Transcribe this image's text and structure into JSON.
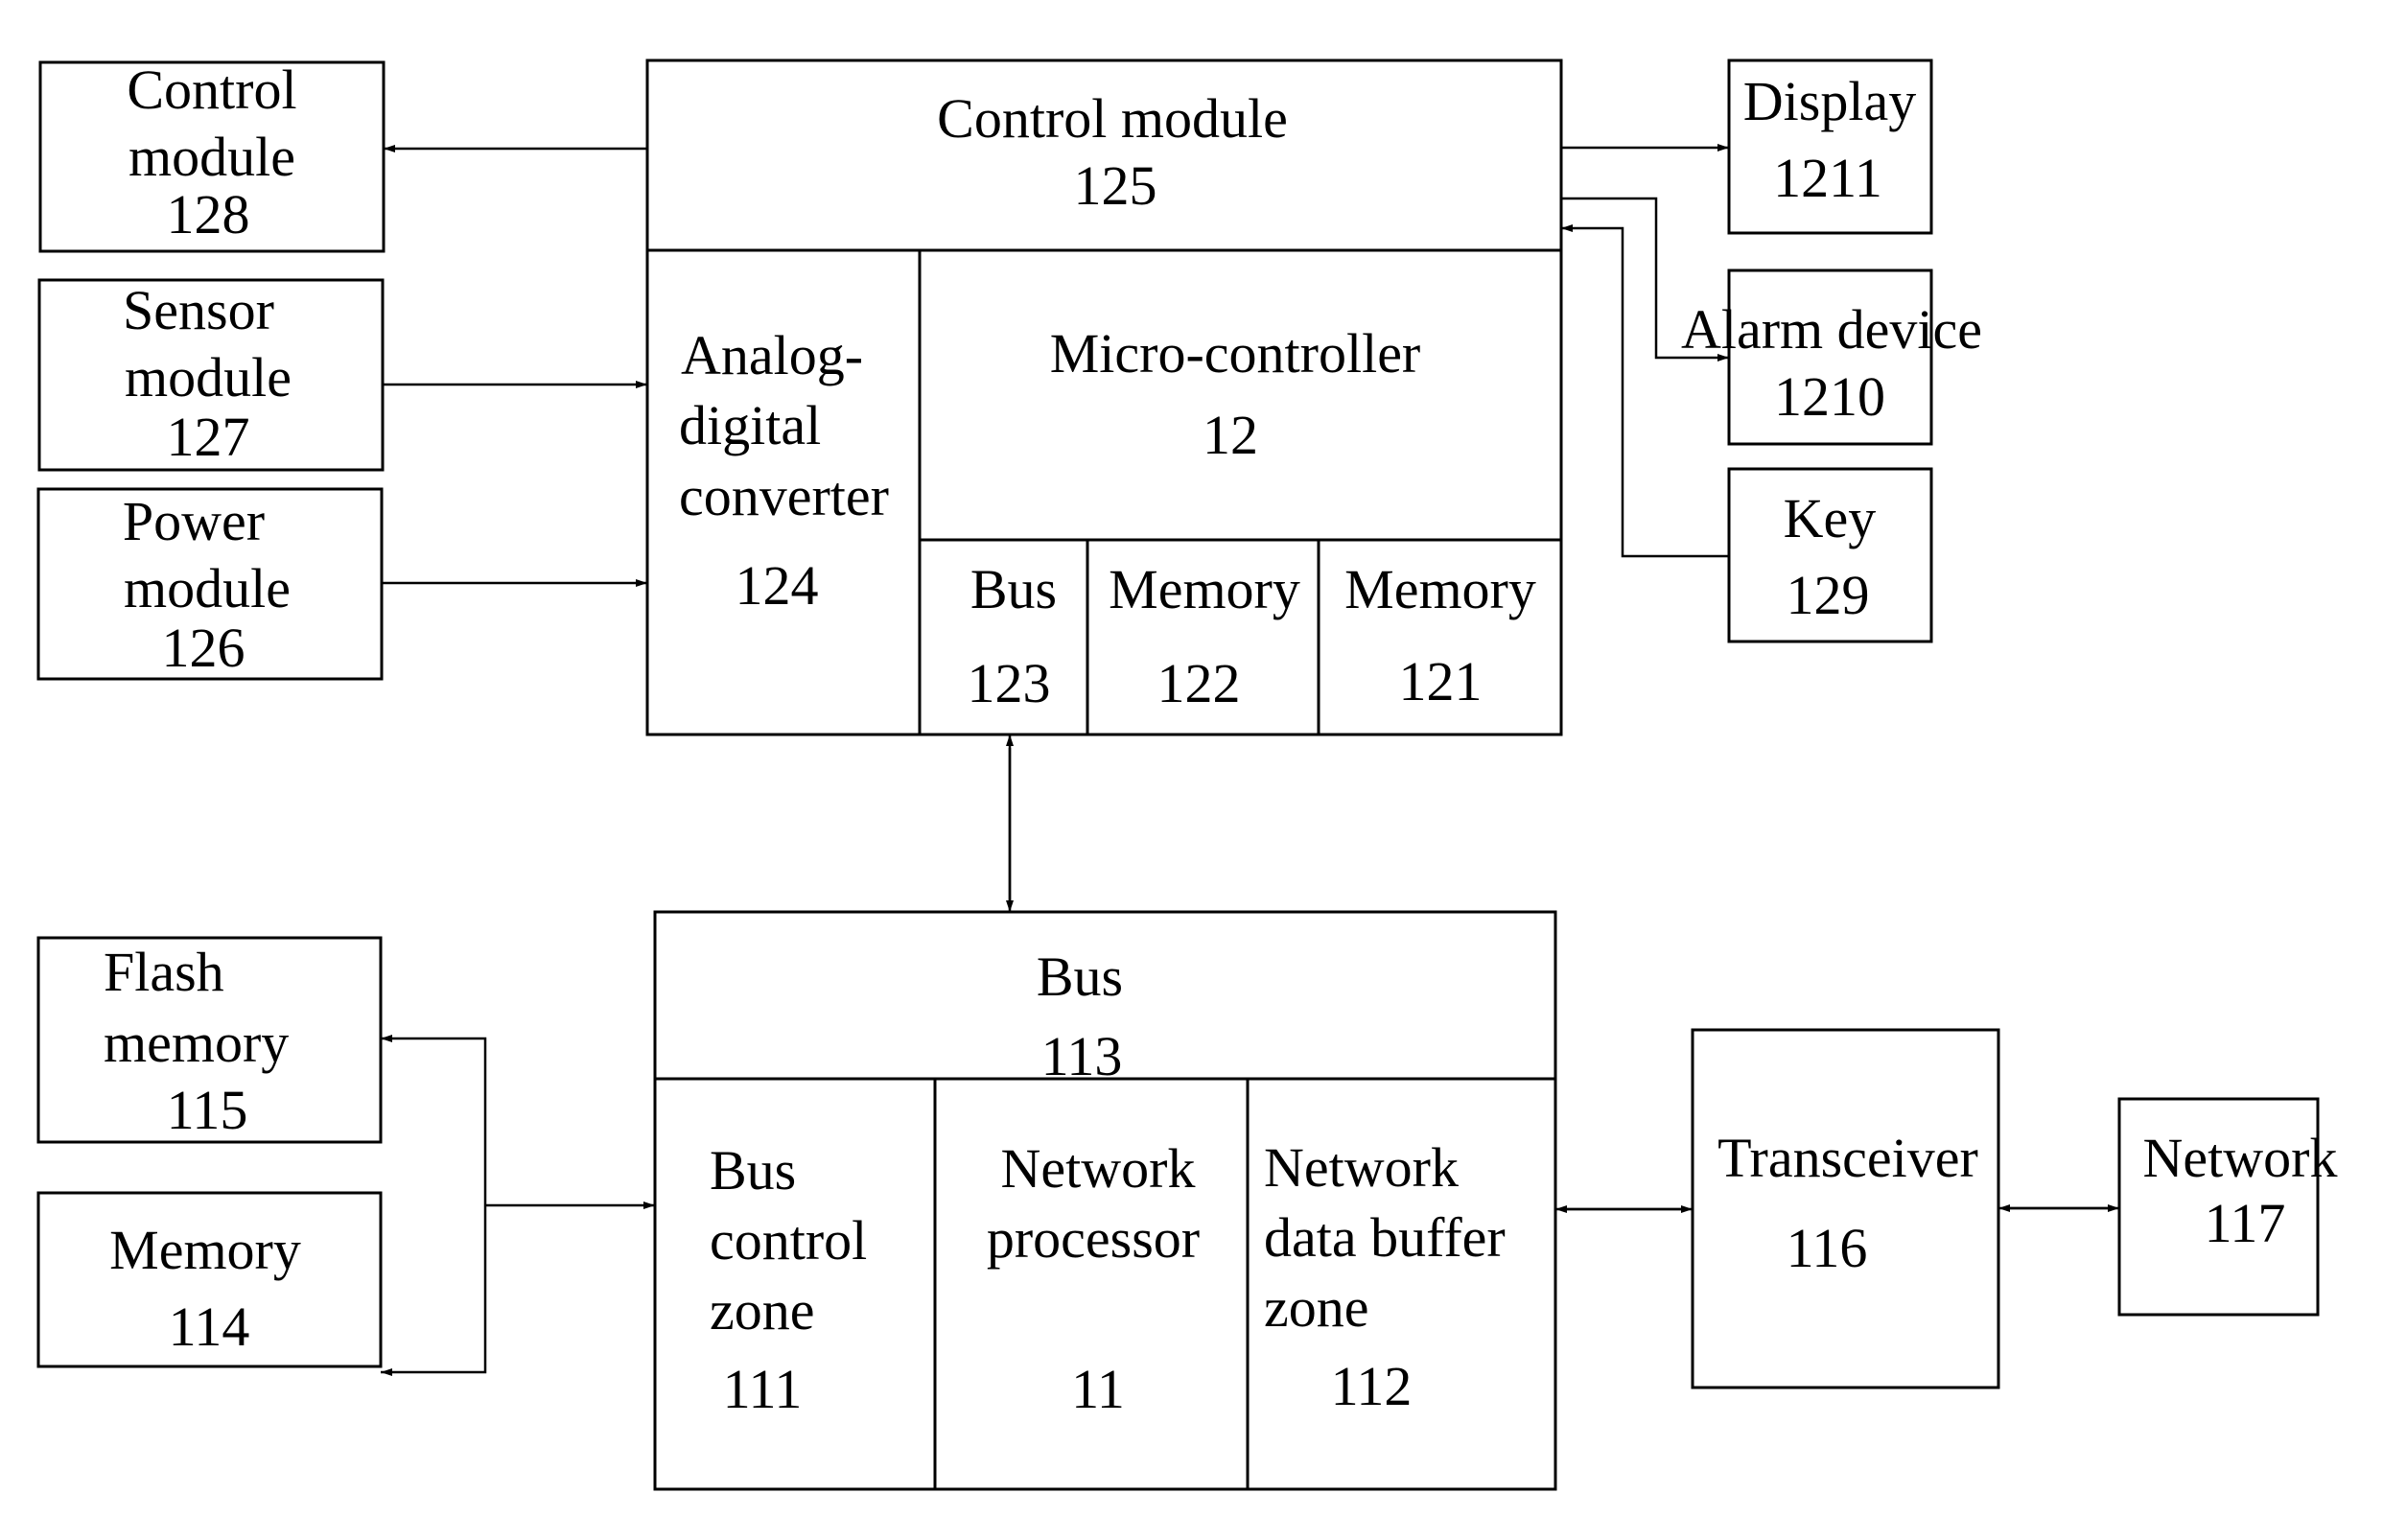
{
  "blocks": {
    "control_module_128": {
      "lines": [
        "Control",
        "module",
        "128"
      ]
    },
    "sensor_module_127": {
      "lines": [
        "Sensor",
        "module",
        "127"
      ]
    },
    "power_module_126": {
      "lines": [
        "Power",
        "module",
        "126"
      ]
    },
    "control_module_125": {
      "lines": [
        "Control module",
        "125"
      ]
    },
    "adc_124": {
      "lines": [
        "Analog-",
        "digital",
        "converter",
        "124"
      ]
    },
    "micro_controller_12": {
      "lines": [
        "Micro-controller",
        "12"
      ]
    },
    "bus_123": {
      "lines": [
        "Bus",
        "123"
      ]
    },
    "memory_122": {
      "lines": [
        "Memory",
        "122"
      ]
    },
    "memory_121": {
      "lines": [
        "Memory",
        "121"
      ]
    },
    "display_1211": {
      "lines": [
        "Display",
        "1211"
      ]
    },
    "alarm_device_1210": {
      "lines": [
        "Alarm device",
        "1210"
      ]
    },
    "key_129": {
      "lines": [
        "Key",
        "129"
      ]
    },
    "flash_memory_115": {
      "lines": [
        "Flash",
        "memory",
        "115"
      ]
    },
    "memory_114": {
      "lines": [
        "Memory",
        "114"
      ]
    },
    "bus_113": {
      "lines": [
        "Bus",
        "113"
      ]
    },
    "bus_control_zone_111": {
      "lines": [
        "Bus",
        "control",
        "zone",
        "111"
      ]
    },
    "network_processor_11": {
      "lines": [
        "Network",
        "processor",
        "11"
      ]
    },
    "network_data_buffer_zone_112": {
      "lines": [
        "Network",
        "data buffer",
        "zone",
        "112"
      ]
    },
    "transceiver_116": {
      "lines": [
        "Transceiver",
        "116"
      ]
    },
    "network_117": {
      "lines": [
        "Network",
        "117"
      ]
    }
  },
  "connections": [
    {
      "from": "control_module_125",
      "to": "control_module_128",
      "direction": "one-way"
    },
    {
      "from": "sensor_module_127",
      "to": "adc_124",
      "direction": "one-way"
    },
    {
      "from": "power_module_126",
      "to": "adc_124",
      "direction": "one-way"
    },
    {
      "from": "control_module_125",
      "to": "display_1211",
      "direction": "one-way"
    },
    {
      "from": "control_module_125",
      "to": "alarm_device_1210",
      "direction": "one-way"
    },
    {
      "from": "key_129",
      "to": "control_module_125",
      "direction": "one-way"
    },
    {
      "from": "bus_123",
      "to": "bus_113",
      "direction": "two-way"
    },
    {
      "from": "bus_control_zone_111",
      "to": "flash_memory_115",
      "direction": "one-way"
    },
    {
      "from": "bus_control_zone_111",
      "to": "memory_114",
      "direction": "one-way"
    },
    {
      "from": "network_data_buffer_zone_112",
      "to": "transceiver_116",
      "direction": "two-way"
    },
    {
      "from": "transceiver_116",
      "to": "network_117",
      "direction": "two-way"
    }
  ]
}
